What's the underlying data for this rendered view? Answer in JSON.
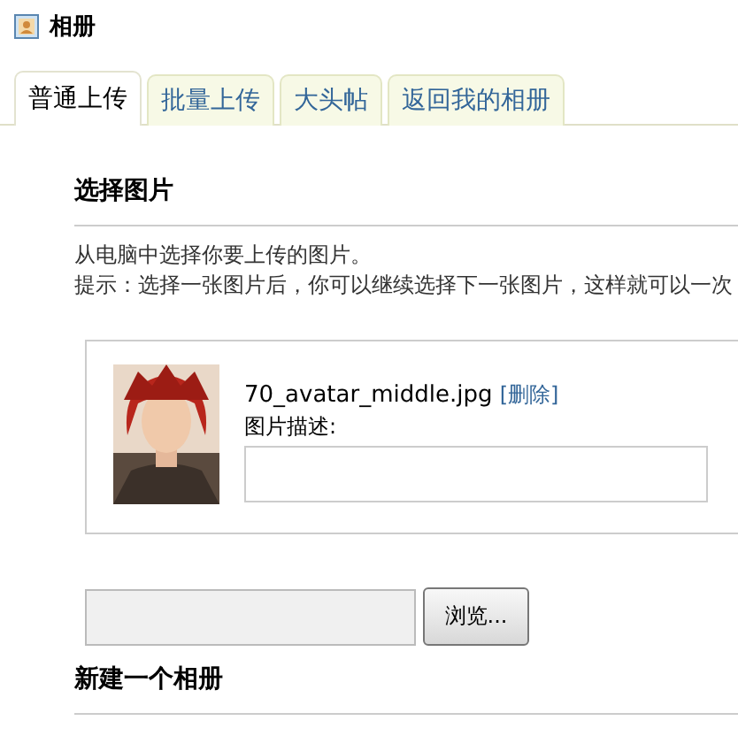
{
  "header": {
    "title": "相册"
  },
  "tabs": [
    {
      "label": "普通上传",
      "selected": true
    },
    {
      "label": "批量上传",
      "selected": false
    },
    {
      "label": "大头帖",
      "selected": false
    },
    {
      "label": "返回我的相册",
      "selected": false
    }
  ],
  "section": {
    "heading": "选择图片",
    "intro": "从电脑中选择你要上传的图片。",
    "hint": "提示：选择一张图片后，你可以继续选择下一张图片，这样就可以一次"
  },
  "upload": {
    "filename": "70_avatar_middle.jpg",
    "delete_link": "[删除]",
    "description_label": "图片描述:"
  },
  "file_input": {
    "button": "浏览..."
  },
  "next_section": {
    "heading": "新建一个相册"
  }
}
